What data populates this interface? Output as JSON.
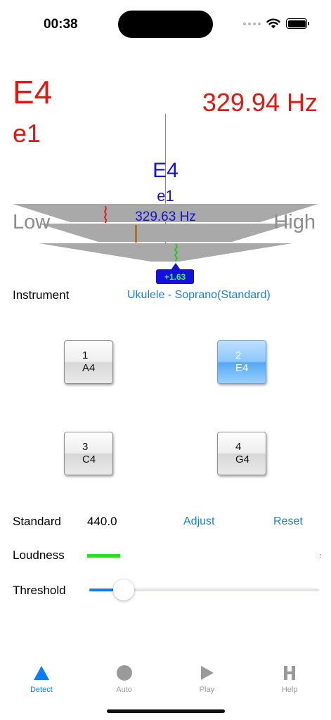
{
  "status": {
    "time": "00:38"
  },
  "detected": {
    "note": "E4",
    "octave_name": "e1",
    "frequency": "329.94 Hz"
  },
  "target": {
    "note": "E4",
    "octave_name": "e1",
    "frequency": "329.63 Hz"
  },
  "meter": {
    "low_label": "Low",
    "high_label": "High",
    "cents": "+1.63",
    "cents_value": 1.63
  },
  "instrument": {
    "label": "Instrument",
    "value": "Ukulele - Soprano(Standard)"
  },
  "strings": [
    {
      "number": "1",
      "note": "A4",
      "active": false
    },
    {
      "number": "2",
      "note": "E4",
      "active": true
    },
    {
      "number": "3",
      "note": "C4",
      "active": false
    },
    {
      "number": "4",
      "note": "G4",
      "active": false
    }
  ],
  "standard": {
    "label": "Standard",
    "value": "440.0",
    "adjust_label": "Adjust",
    "reset_label": "Reset"
  },
  "loudness": {
    "label": "Loudness",
    "level": 0.14
  },
  "threshold": {
    "label": "Threshold",
    "level": 0.15
  },
  "tabs": [
    {
      "label": "Detect",
      "icon": "triangle-icon",
      "active": true
    },
    {
      "label": "Auto",
      "icon": "circle-icon",
      "active": false
    },
    {
      "label": "Play",
      "icon": "play-icon",
      "active": false
    },
    {
      "label": "Help",
      "icon": "help-h-icon",
      "active": false
    }
  ],
  "colors": {
    "detected": "#e8150f",
    "target": "#1410e0",
    "accent": "#0a7cff",
    "loudness": "#28e01b"
  }
}
